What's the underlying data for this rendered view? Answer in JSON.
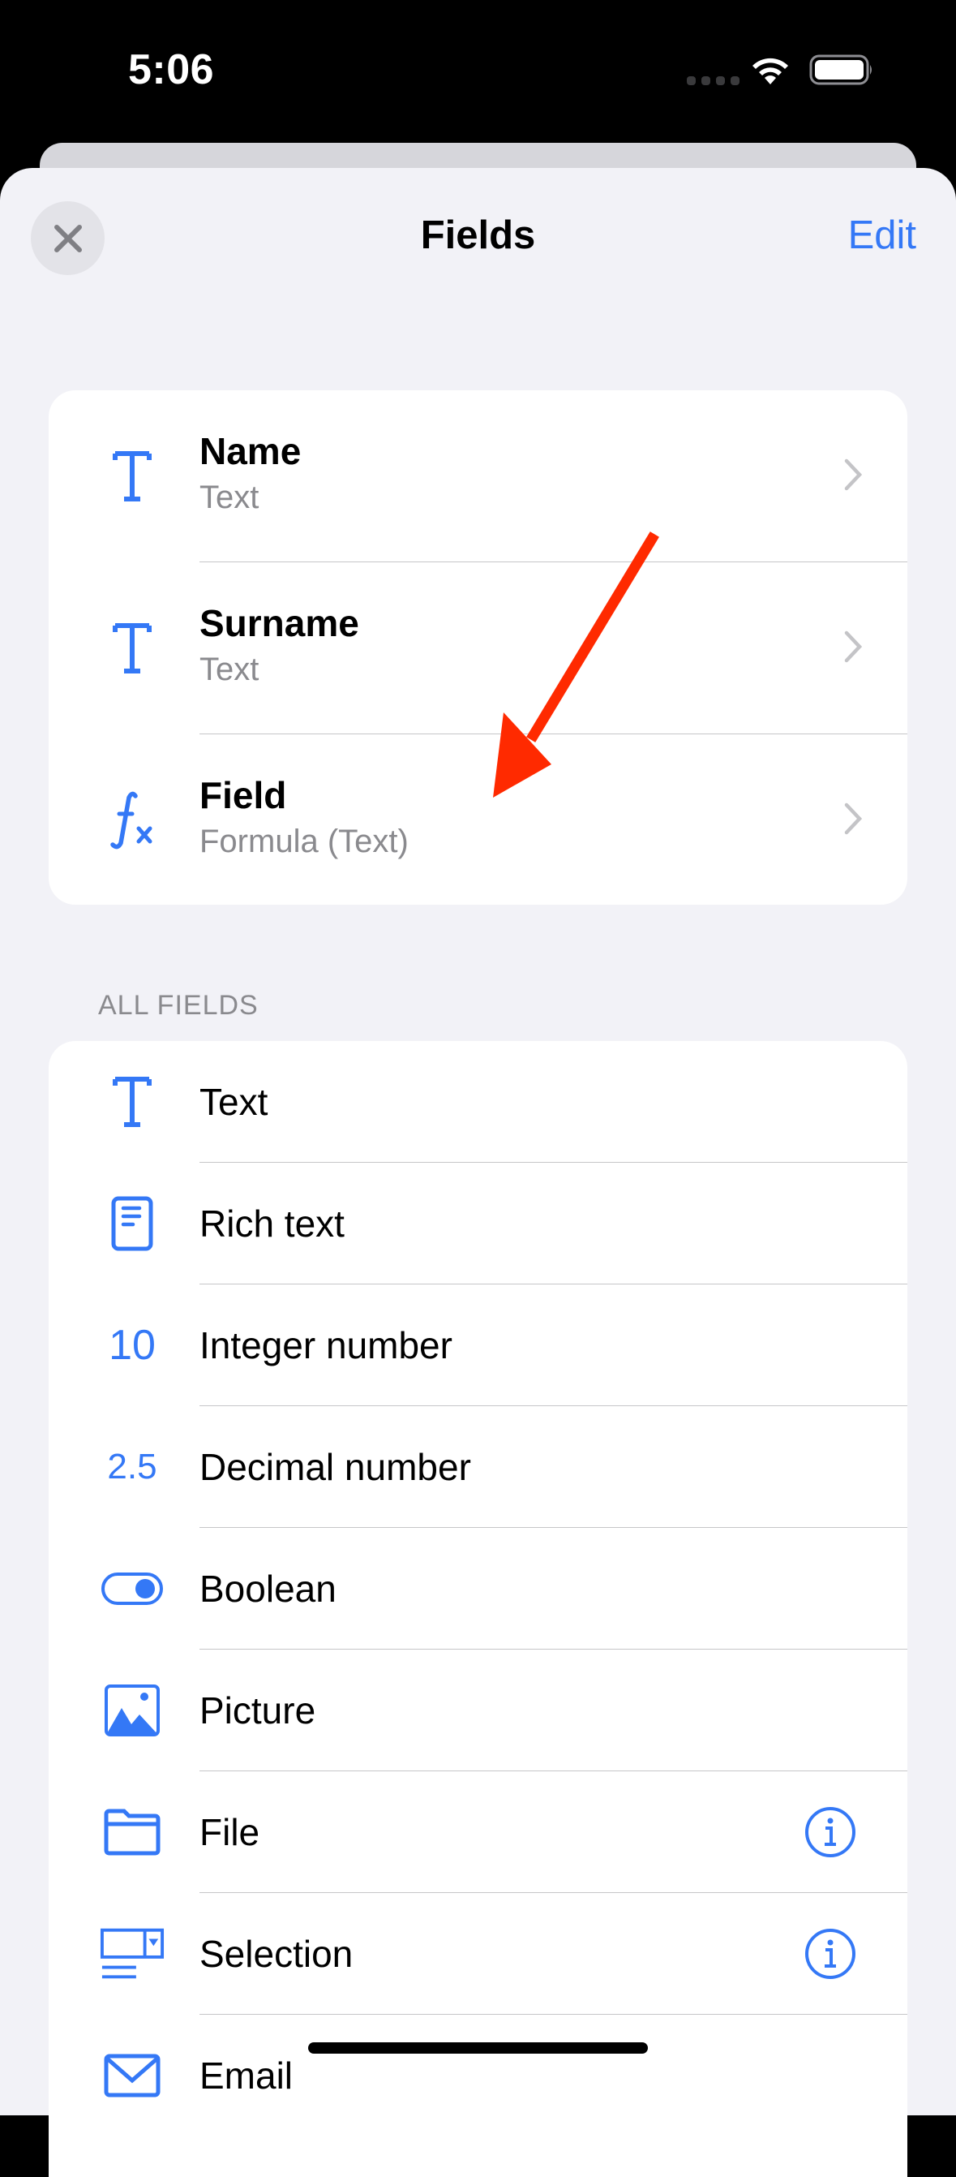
{
  "status_bar": {
    "time": "5:06",
    "icons": [
      "cellular-signal-icon",
      "wifi-icon",
      "battery-icon"
    ]
  },
  "header": {
    "title": "Fields",
    "close_icon": "close-icon",
    "edit_label": "Edit"
  },
  "colors": {
    "accent": "#3478f6",
    "annotation_arrow": "#ff2a00",
    "background": "#f2f2f7",
    "secondary_text": "#8a8a8e"
  },
  "current_fields": [
    {
      "icon": "text-icon",
      "title": "Name",
      "subtitle": "Text"
    },
    {
      "icon": "text-icon",
      "title": "Surname",
      "subtitle": "Text"
    },
    {
      "icon": "formula-icon",
      "title": "Field",
      "subtitle": "Formula (Text)"
    }
  ],
  "all_fields": {
    "header": "ALL FIELDS",
    "items": [
      {
        "icon": "text-icon",
        "label": "Text"
      },
      {
        "icon": "rich-text-icon",
        "label": "Rich text"
      },
      {
        "icon": "integer-icon",
        "icon_text": "10",
        "label": "Integer number"
      },
      {
        "icon": "decimal-icon",
        "icon_text": "2.5",
        "label": "Decimal number"
      },
      {
        "icon": "toggle-icon",
        "label": "Boolean"
      },
      {
        "icon": "picture-icon",
        "label": "Picture"
      },
      {
        "icon": "folder-icon",
        "label": "File",
        "info": true
      },
      {
        "icon": "selection-icon",
        "label": "Selection",
        "info": true
      },
      {
        "icon": "envelope-icon",
        "label": "Email"
      }
    ]
  },
  "annotation": {
    "type": "arrow",
    "points_to": "Field"
  }
}
